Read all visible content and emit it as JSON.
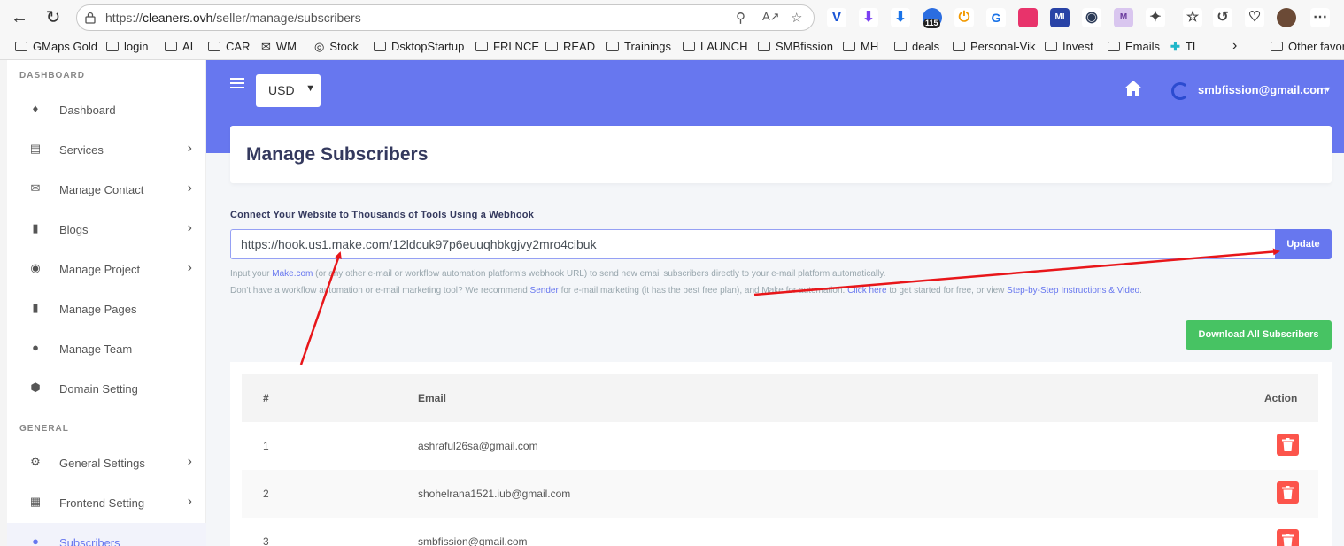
{
  "browser": {
    "url_prefix": "https://",
    "url_host": "cleaners.ovh",
    "url_path": "/seller/manage/subscribers",
    "bookmarks": [
      "GMaps Gold",
      "login",
      "AI",
      "CAR",
      "WM",
      "Stock",
      "DsktopStartup",
      "FRLNCE",
      "READ",
      "Trainings",
      "LAUNCH",
      "SMBfission",
      "MH",
      "deals",
      "Personal-Vik",
      "Invest",
      "Emails",
      "TL"
    ],
    "other_favorites": "Other favor",
    "badge_count": "115"
  },
  "sidebar": {
    "section_dashboard": "DASHBOARD",
    "section_general": "GENERAL",
    "items": [
      {
        "label": "Dashboard",
        "icon": "fire-icon"
      },
      {
        "label": "Services",
        "icon": "briefcase-icon"
      },
      {
        "label": "Manage Contact",
        "icon": "envelope-icon"
      },
      {
        "label": "Blogs",
        "icon": "file-icon"
      },
      {
        "label": "Manage Project",
        "icon": "project-icon"
      },
      {
        "label": "Manage Pages",
        "icon": "page-icon"
      },
      {
        "label": "Manage Team",
        "icon": "team-icon"
      },
      {
        "label": "Domain Setting",
        "icon": "hexagon-icon"
      },
      {
        "label": "General Settings",
        "icon": "cog-icon"
      },
      {
        "label": "Frontend Setting",
        "icon": "grid-icon"
      },
      {
        "label": "Subscribers",
        "icon": "users-icon"
      }
    ]
  },
  "topbar": {
    "currency": "USD",
    "user_email": "smbfission@gmail.com"
  },
  "page": {
    "title": "Manage Subscribers",
    "webhook_label": "Connect Your Website to Thousands of Tools Using a Webhook",
    "webhook_value": "https://hook.us1.make.com/12ldcuk97p6euuqhbkgjvy2mro4cibuk",
    "update_label": "Update",
    "help1_a": "Input your ",
    "help1_link": "Make.com",
    "help1_b": " (or any other e-mail or workflow automation platform's webhook URL) to send new email subscribers directly to your e-mail platform automatically.",
    "help2_a": "Don't have a workflow automation or e-mail marketing tool? We recommend ",
    "help2_link1": "Sender",
    "help2_b": " for e-mail marketing (it has the best free plan), and ",
    "help2_link2": "Make",
    "help2_c": " for automation. ",
    "help2_link3": "Click here",
    "help2_d": " to get started for free, or view ",
    "help2_link4": "Step-by-Step Instructions & Video",
    "help2_e": ".",
    "download_label": "Download All Subscribers"
  },
  "table": {
    "headers": [
      "#",
      "Email",
      "Action"
    ],
    "rows": [
      {
        "num": "1",
        "email": "ashraful26sa@gmail.com"
      },
      {
        "num": "2",
        "email": "shohelrana1521.iub@gmail.com"
      },
      {
        "num": "3",
        "email": "smbfission@gmail.com"
      }
    ]
  },
  "colors": {
    "accent": "#6777ef",
    "success": "#47c363",
    "danger": "#fc544b",
    "annotation": "#e8161a"
  }
}
